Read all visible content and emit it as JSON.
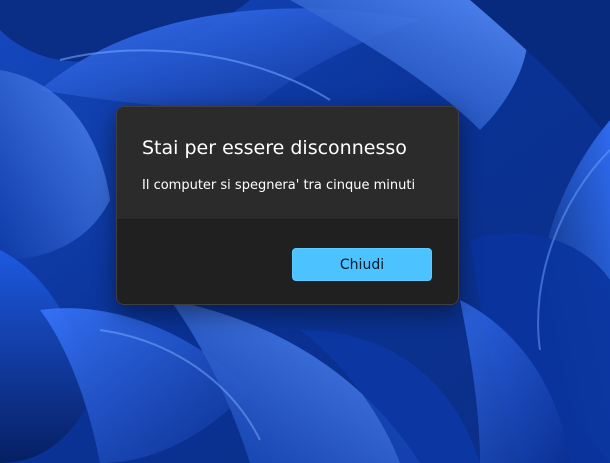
{
  "dialog": {
    "title": "Stai per essere disconnesso",
    "message": "Il computer si spegnera' tra cinque minuti",
    "close_label": "Chiudi"
  },
  "colors": {
    "wallpaper_base": "#0b3aa6",
    "dialog_body": "#2b2b2b",
    "dialog_footer": "#202020",
    "accent_button": "#4cc2ff"
  }
}
